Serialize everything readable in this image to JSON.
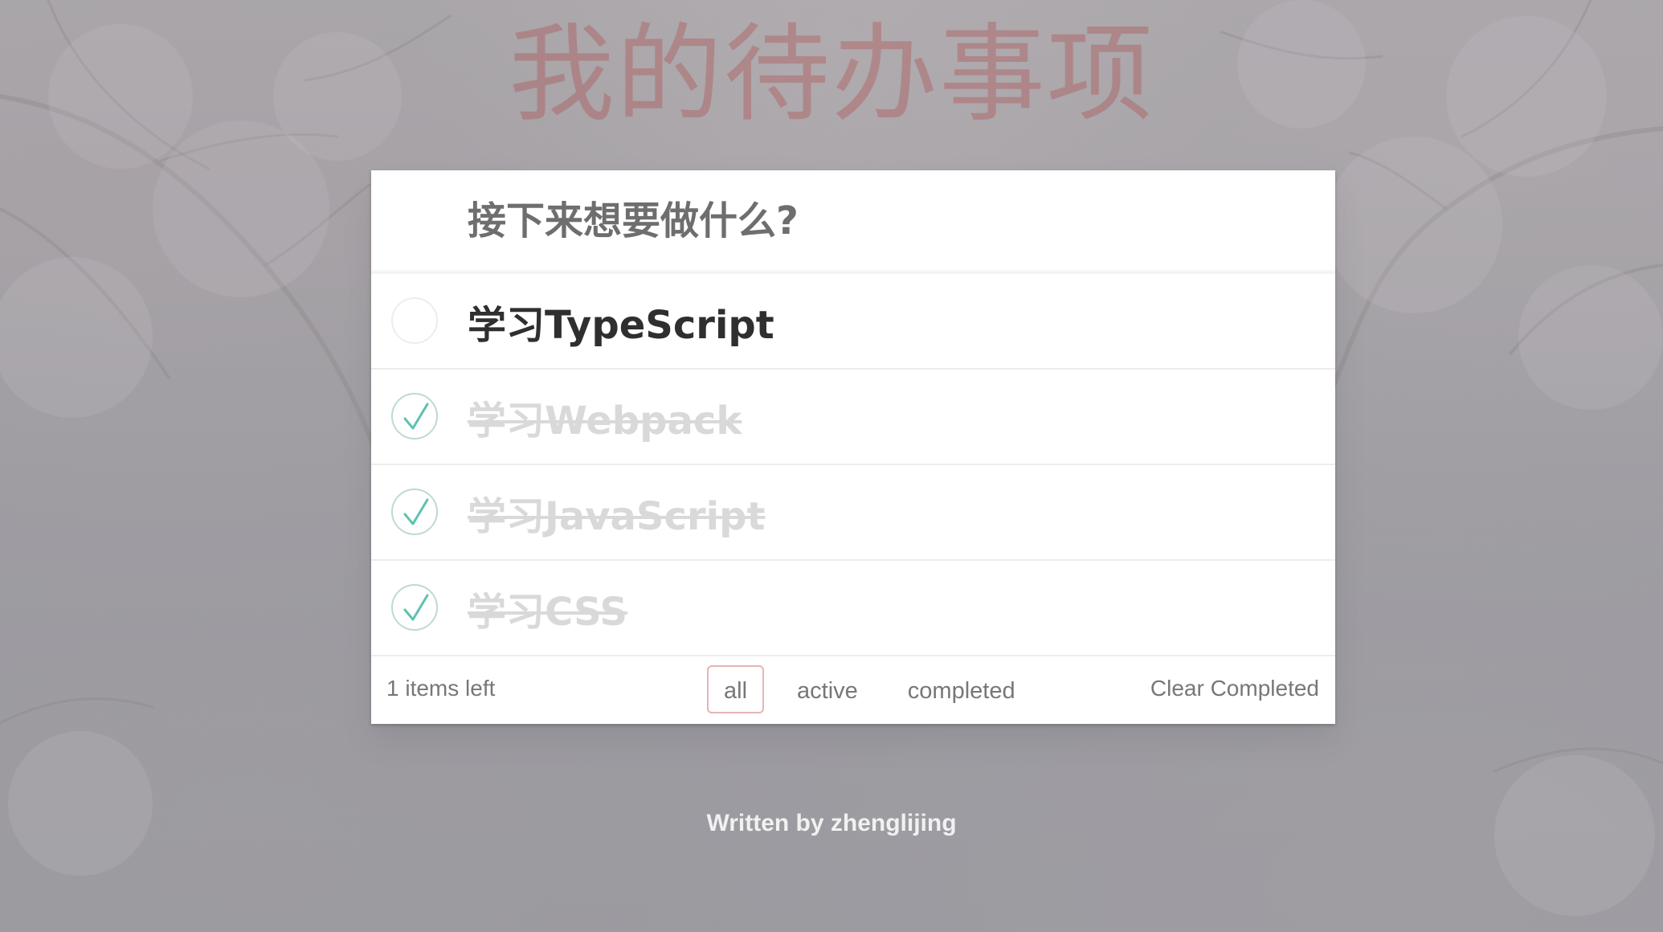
{
  "header": {
    "title": "我的待办事项"
  },
  "new_todo": {
    "placeholder": "接下来想要做什么?",
    "value": ""
  },
  "todos": [
    {
      "label": "学习TypeScript",
      "completed": false
    },
    {
      "label": "学习Webpack",
      "completed": true
    },
    {
      "label": "学习JavaScript",
      "completed": true
    },
    {
      "label": "学习CSS",
      "completed": true
    }
  ],
  "footer": {
    "count_text": "1 items left",
    "filters": [
      {
        "label": "all",
        "selected": true
      },
      {
        "label": "active",
        "selected": false
      },
      {
        "label": "completed",
        "selected": false
      }
    ],
    "clear_label": "Clear Completed"
  },
  "info": {
    "credit": "Written by zhenglijing"
  },
  "colors": {
    "title": "#af2f2f",
    "check": "#5dc2af",
    "selected_filter_border": "#af2f2f"
  }
}
